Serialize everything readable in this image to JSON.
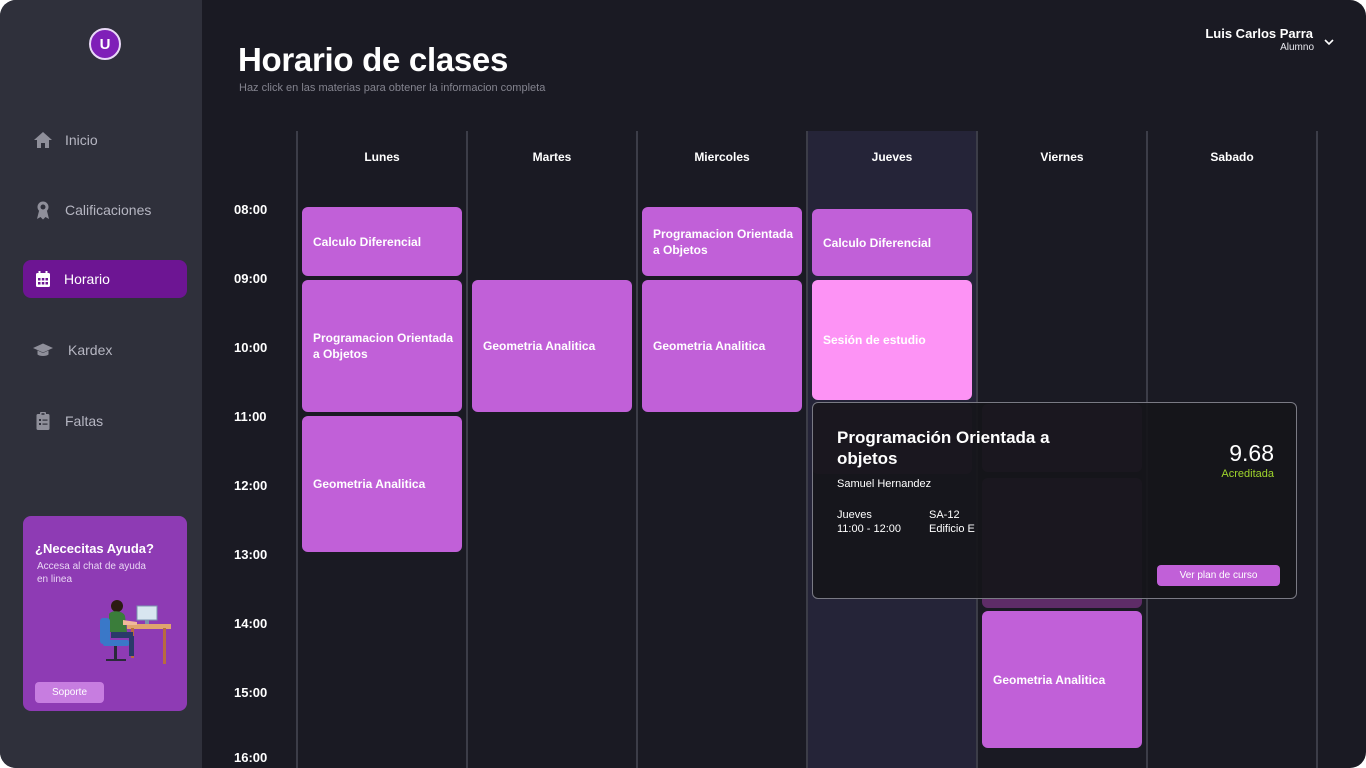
{
  "logo": {
    "text": "U"
  },
  "sidebar": {
    "items": [
      {
        "label": "Inicio",
        "icon": "home-icon"
      },
      {
        "label": "Calificaciones",
        "icon": "award-icon"
      },
      {
        "label": "Horario",
        "icon": "calendar-icon",
        "active": true
      },
      {
        "label": "Kardex",
        "icon": "graduation-cap-icon"
      },
      {
        "label": "Faltas",
        "icon": "clipboard-icon"
      }
    ],
    "help": {
      "title": "¿Nececitas Ayuda?",
      "text": "Accesa al chat de ayuda en linea",
      "button": "Soporte"
    }
  },
  "header": {
    "title": "Horario de clases",
    "subtitle": "Haz click en las materias para obtener la informacion completa"
  },
  "user": {
    "name": "Luis Carlos Parra",
    "role": "Alumno"
  },
  "schedule": {
    "days": [
      "Lunes",
      "Martes",
      "Miercoles",
      "Jueves",
      "Viernes",
      "Sabado"
    ],
    "current_day": "Jueves",
    "times": [
      "08:00",
      "09:00",
      "10:00",
      "11:00",
      "12:00",
      "13:00",
      "14:00",
      "15:00",
      "16:00"
    ],
    "events": [
      {
        "day": "Lunes",
        "title": "Calculo Diferencial"
      },
      {
        "day": "Lunes",
        "title": "Programacion Orientada a Objetos"
      },
      {
        "day": "Lunes",
        "title": "Geometria Analitica"
      },
      {
        "day": "Martes",
        "title": "Geometria Analitica"
      },
      {
        "day": "Miercoles",
        "title": "Programacion Orientada a Objetos"
      },
      {
        "day": "Miercoles",
        "title": "Geometria Analitica"
      },
      {
        "day": "Jueves",
        "title": "Calculo Diferencial"
      },
      {
        "day": "Jueves",
        "title": "Sesión de estudio"
      },
      {
        "day": "Viernes",
        "title": "Geometria Analitica"
      }
    ]
  },
  "popup": {
    "title": "Programación Orientada a objetos",
    "teacher": "Samuel Hernandez",
    "day": "Jueves",
    "time": "11:00 - 12:00",
    "room": "SA-12",
    "building": "Edificio E",
    "grade": "9.68",
    "status": "Acreditada",
    "button": "Ver plan de curso"
  },
  "colors": {
    "background": "#1a1a23",
    "sidebar": "#2f303b",
    "accent": "#6d1593",
    "event": "#c160d8",
    "study": "#fd93f5",
    "status_ok": "#9fd52c"
  }
}
